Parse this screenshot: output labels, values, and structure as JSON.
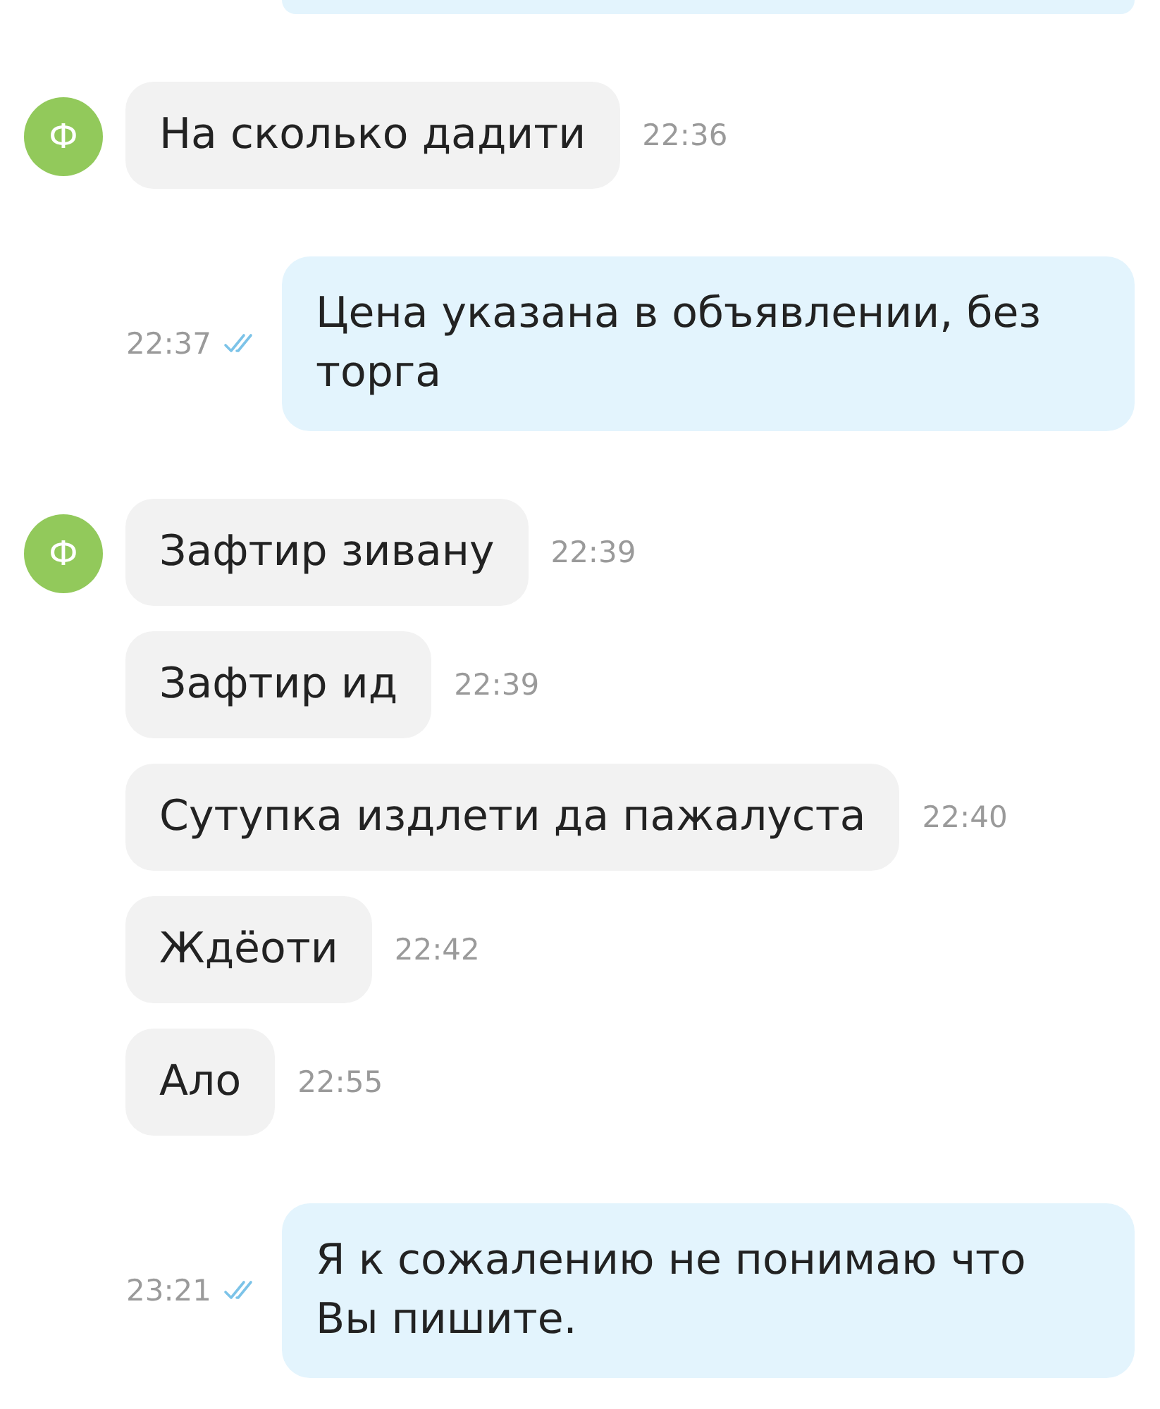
{
  "clipped_outgoing_bubble": true,
  "messages": [
    {
      "kind": "incoming",
      "avatar": "Ф",
      "text": "На сколько дадити",
      "time": "22:36"
    },
    {
      "kind": "outgoing",
      "text": "Цена указана в объявлении, без торга",
      "time": "22:37",
      "read": true
    },
    {
      "kind": "incoming",
      "avatar": "Ф",
      "text": "Зафтир зивану",
      "time": "22:39"
    },
    {
      "kind": "incoming",
      "text": "Зафтир ид",
      "time": "22:39"
    },
    {
      "kind": "incoming",
      "text": "Сутупка издлети да пажалуста",
      "time": "22:40"
    },
    {
      "kind": "incoming",
      "text": "Ждёоти",
      "time": "22:42"
    },
    {
      "kind": "incoming",
      "text": "Ало",
      "time": "22:55"
    },
    {
      "kind": "outgoing",
      "text": "Я к сожалению не понимаю что Вы пишите.",
      "time": "23:21",
      "read": true
    }
  ]
}
